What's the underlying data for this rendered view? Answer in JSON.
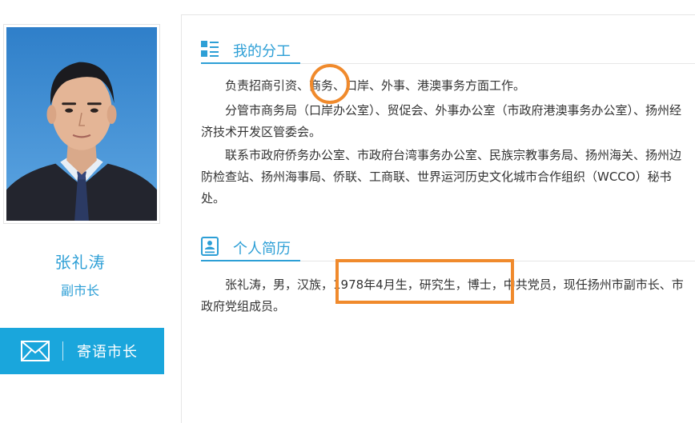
{
  "profile": {
    "name": "张礼涛",
    "title": "副市长",
    "mail_button_label": "寄语市长"
  },
  "sections": [
    {
      "title": "我的分工",
      "icon": "list-icon",
      "paragraphs": [
        "负责招商引资、商务、口岸、外事、港澳事务方面工作。",
        "分管市商务局（口岸办公室）、贸促会、外事办公室（市政府港澳事务办公室）、扬州经济技术开发区管委会。",
        "联系市政府侨务办公室、市政府台湾事务办公室、民族宗教事务局、扬州海关、扬州边防检查站、扬州海事局、侨联、工商联、世界运河历史文化城市合作组织（WCCO）秘书处。"
      ]
    },
    {
      "title": "个人简历",
      "icon": "resume-icon",
      "paragraphs": [
        "张礼涛，男，汉族，1978年4月生，研究生，博士，中共党员，现任扬州市副市长、市政府党组成员。"
      ]
    }
  ],
  "colors": {
    "accent": "#2d9fd6",
    "button": "#1aa6dc",
    "annotation": "#f08a2c"
  }
}
